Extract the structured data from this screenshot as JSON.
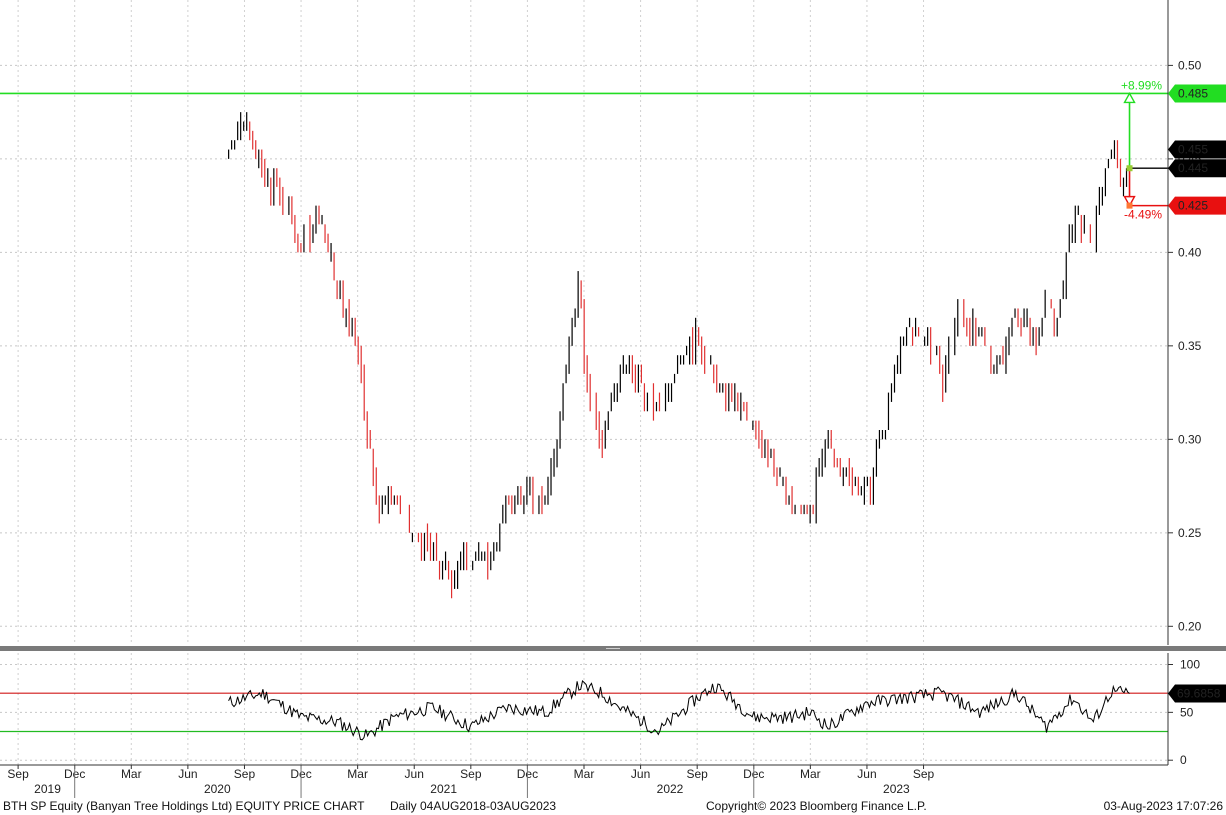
{
  "chart_data": {
    "type": "candlestick",
    "title": "BTH SP Equity (Banyan Tree Holdings Ltd) EQUITY PRICE CHART",
    "range_text": "Daily 04AUG2018-03AUG2023",
    "copyright": "Copyright© 2023 Bloomberg Finance L.P.",
    "timestamp": "03-Aug-2023 17:07:26",
    "colors": {
      "up": "#000000",
      "down": "#e03030",
      "target": "#22dd22",
      "stop": "#e81010"
    },
    "price_panel": {
      "ylim": [
        0.19,
        0.52
      ],
      "yticks": [
        "0.20",
        "0.25",
        "0.30",
        "0.35",
        "0.40",
        "0.45",
        "0.50"
      ],
      "ytick_values": [
        0.2,
        0.25,
        0.3,
        0.35,
        0.4,
        0.45,
        0.5
      ],
      "grid": true,
      "axis_side": "right",
      "series": {
        "x": [
          2019.6,
          2019.67,
          2019.75,
          2019.83,
          2019.92,
          2020.0,
          2020.08,
          2020.17,
          2020.21,
          2020.25,
          2020.33,
          2020.42,
          2020.5,
          2020.58,
          2020.67,
          2020.75,
          2020.83,
          2020.92,
          2021.0,
          2021.08,
          2021.15,
          2021.17,
          2021.25,
          2021.33,
          2021.42,
          2021.5,
          2021.58,
          2021.67,
          2021.75,
          2021.83,
          2021.92,
          2022.0,
          2022.08,
          2022.17,
          2022.25,
          2022.33,
          2022.42,
          2022.5,
          2022.58,
          2022.67,
          2022.75,
          2022.83,
          2022.92,
          2023.0,
          2023.08,
          2023.17,
          2023.21,
          2023.25,
          2023.33,
          2023.42,
          2023.5,
          2023.54,
          2023.58
        ],
        "close": [
          0.455,
          0.475,
          0.44,
          0.43,
          0.405,
          0.42,
          0.38,
          0.35,
          0.31,
          0.265,
          0.27,
          0.245,
          0.24,
          0.225,
          0.24,
          0.235,
          0.265,
          0.27,
          0.265,
          0.33,
          0.39,
          0.34,
          0.3,
          0.34,
          0.33,
          0.315,
          0.345,
          0.355,
          0.33,
          0.32,
          0.305,
          0.29,
          0.265,
          0.26,
          0.3,
          0.28,
          0.27,
          0.31,
          0.355,
          0.36,
          0.33,
          0.37,
          0.35,
          0.34,
          0.37,
          0.35,
          0.385,
          0.355,
          0.42,
          0.405,
          0.46,
          0.44,
          0.445
        ]
      },
      "current_label": "0.455",
      "lines": [
        {
          "name": "Target",
          "value": 0.485,
          "label": "0.485",
          "pct": "+8.99%"
        },
        {
          "name": "Entry",
          "value": 0.445,
          "label": "0.445"
        },
        {
          "name": "Stop",
          "value": 0.425,
          "label": "0.425",
          "pct": "-4.49%"
        }
      ]
    },
    "rsi_panel": {
      "ylim": [
        -5,
        112
      ],
      "yticks": [
        "0",
        "50",
        "100"
      ],
      "ytick_values": [
        0,
        50,
        100
      ],
      "upper": 70,
      "lower": 30,
      "current": "69.6858",
      "x": [
        2019.6,
        2019.75,
        2019.92,
        2020.08,
        2020.21,
        2020.33,
        2020.5,
        2020.67,
        2020.83,
        2021.0,
        2021.08,
        2021.15,
        2021.25,
        2021.33,
        2021.5,
        2021.67,
        2021.75,
        2021.92,
        2022.08,
        2022.17,
        2022.25,
        2022.42,
        2022.58,
        2022.75,
        2022.92,
        2023.08,
        2023.21,
        2023.33,
        2023.42,
        2023.5,
        2023.58
      ],
      "values": [
        60,
        70,
        45,
        40,
        25,
        45,
        55,
        35,
        55,
        50,
        65,
        78,
        70,
        55,
        30,
        65,
        78,
        45,
        45,
        50,
        35,
        60,
        65,
        70,
        50,
        70,
        35,
        65,
        40,
        72,
        69.7
      ]
    },
    "x_axis": {
      "months": [
        {
          "label": "Sep",
          "x": 2018.67
        },
        {
          "label": "Dec",
          "x": 2018.92
        },
        {
          "label": "Mar",
          "x": 2019.17
        },
        {
          "label": "Jun",
          "x": 2019.42
        },
        {
          "label": "Sep",
          "x": 2019.67
        },
        {
          "label": "Dec",
          "x": 2019.92
        },
        {
          "label": "Mar",
          "x": 2020.17
        },
        {
          "label": "Jun",
          "x": 2020.42
        },
        {
          "label": "Sep",
          "x": 2020.67
        },
        {
          "label": "Dec",
          "x": 2020.92
        },
        {
          "label": "Mar",
          "x": 2021.17
        },
        {
          "label": "Jun",
          "x": 2021.42
        },
        {
          "label": "Sep",
          "x": 2021.67
        },
        {
          "label": "Dec",
          "x": 2021.92
        },
        {
          "label": "Mar",
          "x": 2022.17
        },
        {
          "label": "Jun",
          "x": 2022.42
        },
        {
          "label": "Sep",
          "x": 2022.67
        }
      ],
      "years": [
        {
          "label": "2019",
          "x": 2018.8
        },
        {
          "label": "2020",
          "x": 2019.55
        },
        {
          "label": "2021",
          "x": 2020.55
        },
        {
          "label": "2022",
          "x": 2021.55
        },
        {
          "label": "2023",
          "x": 2022.55
        }
      ],
      "year_dividers": [
        2018.92,
        2019.92,
        2020.92,
        2021.92
      ]
    }
  }
}
